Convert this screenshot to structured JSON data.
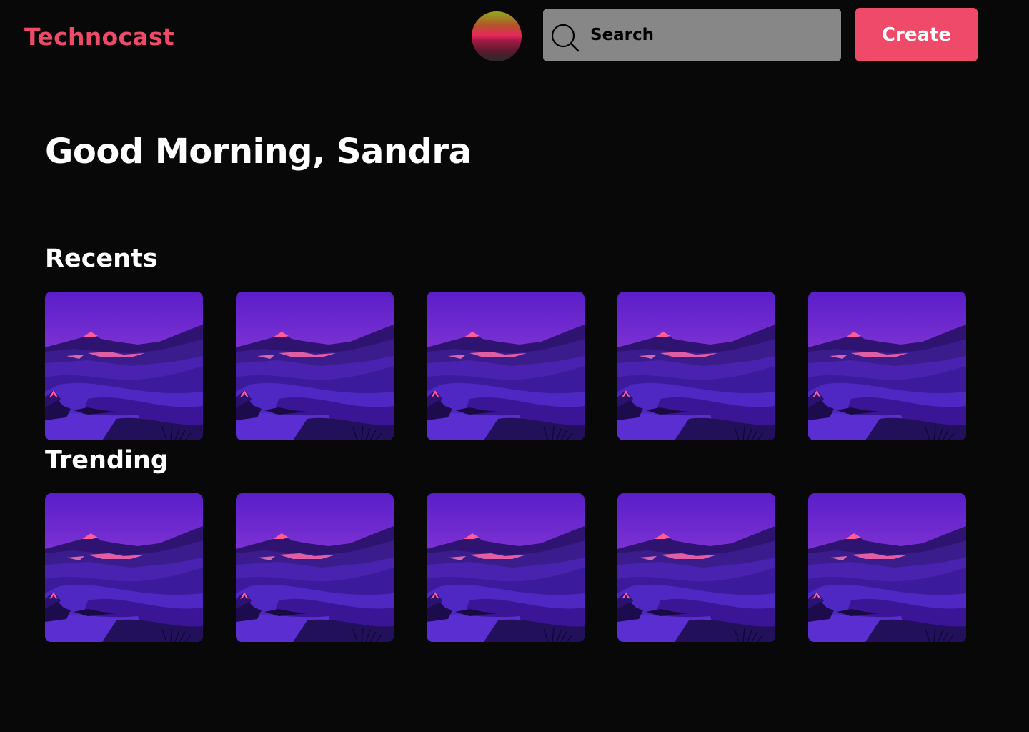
{
  "header": {
    "logo": "Technocast",
    "search_placeholder": "Search",
    "create_label": "Create"
  },
  "greeting": "Good Morning, Sandra",
  "sections": [
    {
      "title": "Recents",
      "item_count": 5
    },
    {
      "title": "Trending",
      "item_count": 5
    }
  ],
  "colors": {
    "background": "#080808",
    "accent": "#ef4a6a",
    "search_bg": "#878787"
  },
  "icons": {
    "search": "search-icon",
    "avatar": "user-avatar"
  }
}
